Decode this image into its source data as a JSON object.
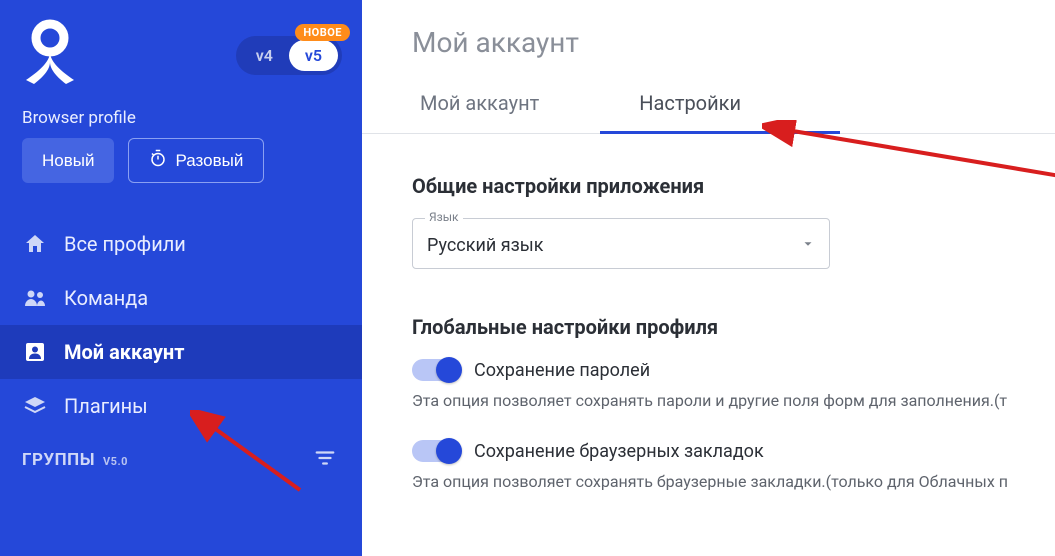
{
  "sidebar": {
    "version": {
      "left": "v4",
      "right": "v5",
      "badge": "НОВОЕ"
    },
    "profile_label": "Browser profile",
    "btn_new": "Новый",
    "btn_disposable": "Разовый",
    "nav": {
      "all_profiles": "Все профили",
      "team": "Команда",
      "my_account": "Мой аккаунт",
      "plugins": "Плагины"
    },
    "groups": {
      "label": "ГРУППЫ",
      "ver": "V5.0"
    }
  },
  "main": {
    "title": "Мой аккаунт",
    "tabs": {
      "account": "Мой аккаунт",
      "settings": "Настройки"
    },
    "section_app": {
      "heading": "Общие настройки приложения",
      "lang_legend": "Язык",
      "lang_value": "Русский язык"
    },
    "section_profile": {
      "heading": "Глобальные настройки профиля",
      "toggle1_label": "Сохранение паролей",
      "toggle1_desc": "Эта опция позволяет сохранять пароли и другие поля форм для заполнения.(т",
      "toggle2_label": "Сохранение браузерных закладок",
      "toggle2_desc": "Эта опция позволяет сохранять браузерные закладки.(только для Облачных п"
    }
  }
}
